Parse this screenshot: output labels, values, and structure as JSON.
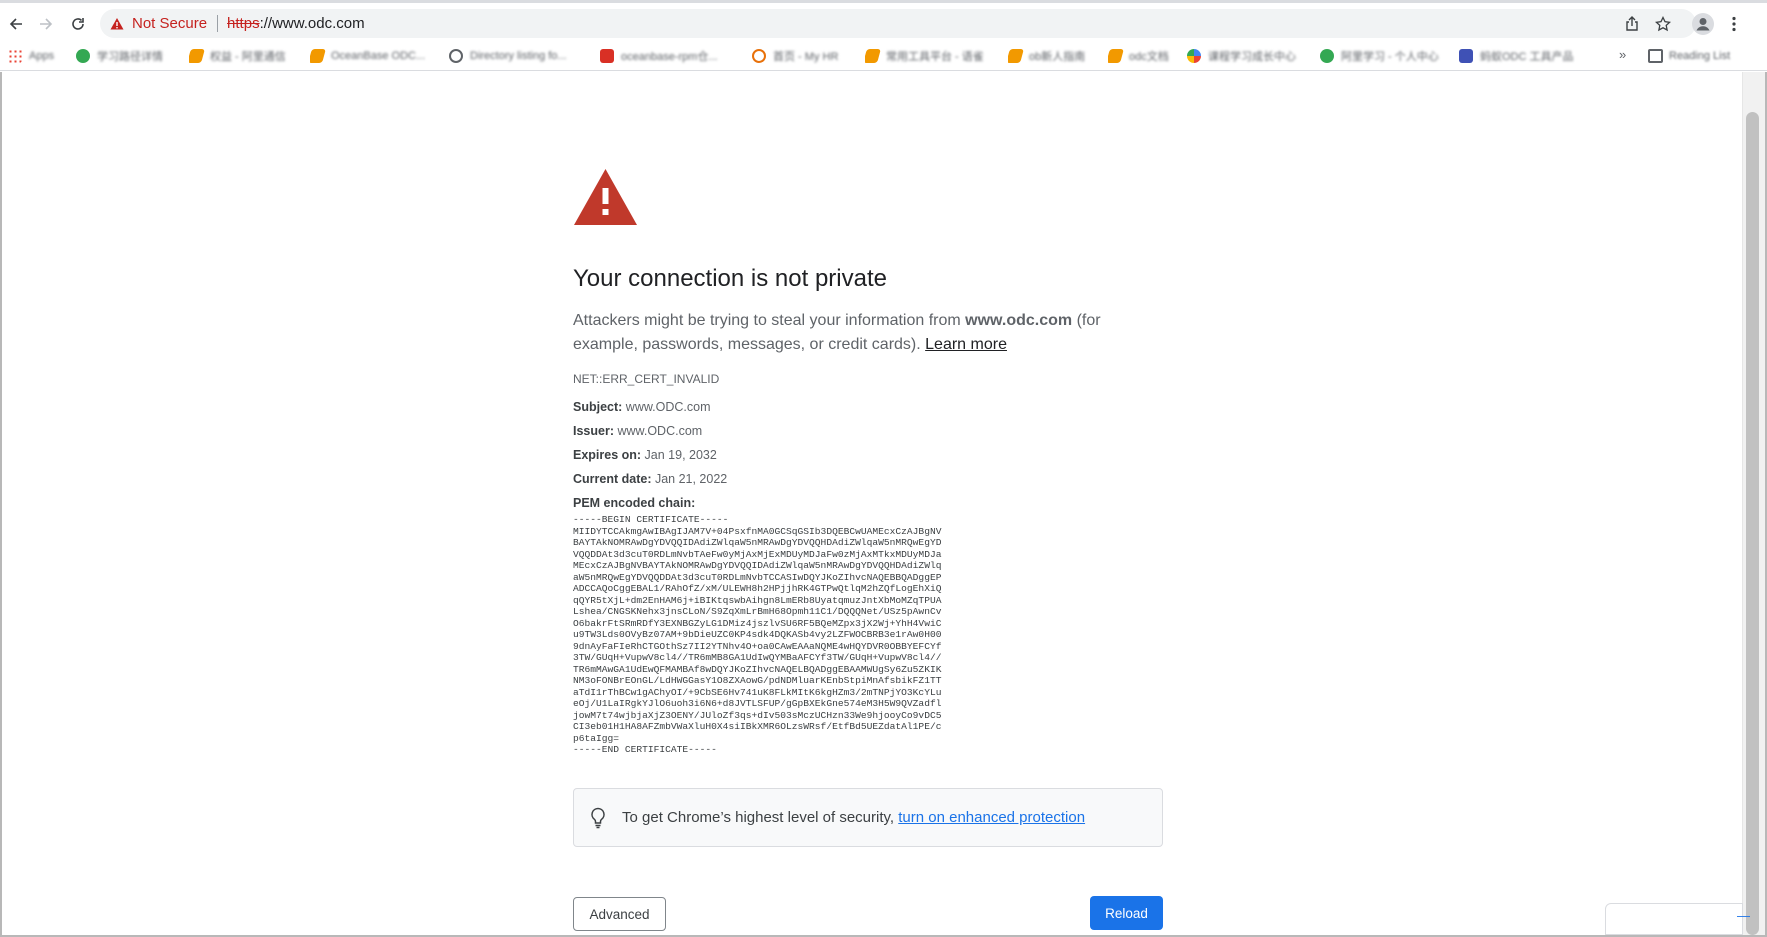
{
  "toolbar": {
    "security_label": "Not Secure",
    "url_scheme": "https",
    "url_rest": "://www.odc.com",
    "icons": [
      "back-arrow-icon",
      "forward-arrow-icon",
      "reload-icon",
      "warning-triangle-icon",
      "share-icon",
      "star-icon",
      "profile-icon",
      "more-vert-icon"
    ]
  },
  "bookmarks": {
    "items": [
      {
        "label": "Apps",
        "color": "#ea4335"
      },
      {
        "label": "学习路径详情",
        "color": "#34a853"
      },
      {
        "label": "权益 - 阿里通信",
        "color": "#f29900"
      },
      {
        "label": "OceanBase ODC...",
        "color": "#f29900"
      },
      {
        "label": "Directory listing fo...",
        "color": "#5f6368"
      },
      {
        "label": "oceanbase-rpm仓...",
        "color": "#d93025"
      },
      {
        "label": "首页 - My HR",
        "color": "#e8710a"
      },
      {
        "label": "常用工具平台 - 语雀",
        "color": "#f29900"
      },
      {
        "label": "ob新人指南",
        "color": "#f29900"
      },
      {
        "label": "odc文档",
        "color": "#f29900"
      },
      {
        "label": "课程学习成长中心",
        "color": "#4285f4"
      },
      {
        "label": "阿里学习 - 个人中心",
        "color": "#34a853"
      },
      {
        "label": "蚂蚁ODC 工具产品",
        "color": "#3f51b5"
      }
    ],
    "more_label": "»",
    "reading_list_label": "Reading List"
  },
  "interstitial": {
    "heading": "Your connection is not private",
    "explanation_prefix": "Attackers might be trying to steal your information from ",
    "explanation_host": "www.odc.com",
    "explanation_suffix": " (for example, passwords, messages, or credit cards). ",
    "learn_more": "Learn more",
    "error_code": "NET::ERR_CERT_INVALID",
    "cert": {
      "subject_label": "Subject:",
      "subject_value": " www.ODC.com",
      "issuer_label": "Issuer:",
      "issuer_value": " www.ODC.com",
      "expires_label": "Expires on:",
      "expires_value": " Jan 19, 2032",
      "current_label": "Current date:",
      "current_value": " Jan 21, 2022",
      "pem_label": "PEM encoded chain:",
      "pem": "-----BEGIN CERTIFICATE-----\nMIIDYTCCAkmgAwIBAgIJAM7V+04PsxfnMA0GCSqGSIb3DQEBCwUAMEcxCzAJBgNV\nBAYTAkNOMRAwDgYDVQQIDAdiZWlqaW5nMRAwDgYDVQQHDAdiZWlqaW5nMRQwEgYD\nVQQDDAt3d3cuT0RDLmNvbTAeFw0yMjAxMjExMDUyMDJaFw0zMjAxMTkxMDUyMDJa\nMEcxCzAJBgNVBAYTAkNOMRAwDgYDVQQIDAdiZWlqaW5nMRAwDgYDVQQHDAdiZWlq\naW5nMRQwEgYDVQQDDAt3d3cuT0RDLmNvbTCCASIwDQYJKoZIhvcNAQEBBQADggEP\nADCCAQoCggEBAL1/RAhOfZ/xM/ULEWH8h2HPjjhRK4GTPwQtlqM2hZQfLogEhXiQ\nqQYR5tXjL+dm2EnHAM6j+iBIKtqswbAihgn8LmERb8UyatqmuzJntXbMoMZqTPUA\nLshea/CNGSKNehx3jnsCLoN/S9ZqXmLrBmH68Opmh11C1/DQQQNet/USz5pAwnCv\nO6bakrFtSRmRDfY3EXNBGZyLG1DMiz4jszlvSU6RF5BQeMZpx3jX2Wj+YhH4VwiC\nu9TW3Lds0OVyBz07AM+9bDieUZC0KP4sdk4DQKASb4vy2LZFWOCBRB3e1rAw0H00\n9dnAyFaFIeRhCTGOthSz7II2YTNhv4O+oa0CAwEAAaNQME4wHQYDVR0OBBYEFCYf\n3TW/GUqH+VupwV8cl4//TR6mMB8GA1UdIwQYMBaAFCYf3TW/GUqH+VupwV8cl4//\nTR6mMAwGA1UdEwQFMAMBAf8wDQYJKoZIhvcNAQELBQADggEBAAMWUgSy6Zu5ZKIK\nNM3oFONBrEOnGL/LdHWGGasY1O8ZXAowG/pdNDMluarKEnbStpiMnAfsbikFZ1TT\naTdI1rThBCw1gAChyOI/+9CbSE6Hv741uK8FLkMItK6kgHZm3/2mTNPjYO3KcYLu\neOj/U1LaIRgkYJlO6uoh3i6N6+d8JVTLSFUP/gGpBXEkGne574eM3H5W9QVZadfl\njowM7t74wjbjaXjZ3OENY/JUloZf3qs+dIv503sMczUCHzn33We9hjooyCo9vDC5\nCI3eb01H1HA8AFZmbVWaXluH0X4siIBkXMR6OLzsWRsf/EtfBd5UEZdatAl1PE/c\np6taIgg=\n-----END CERTIFICATE-----"
    },
    "enhanced_prefix": "To get Chrome’s highest level of security, ",
    "enhanced_link": "turn on enhanced protection",
    "advanced_label": "Advanced",
    "reload_label": "Reload"
  },
  "colors": {
    "danger": "#c5221f",
    "accent": "#1a73e8",
    "warning_triangle": "#c0392b"
  }
}
